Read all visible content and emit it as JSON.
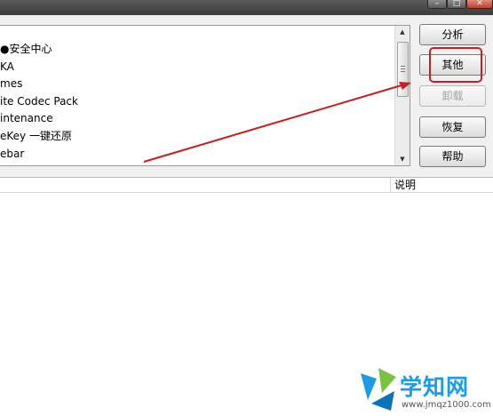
{
  "list": {
    "items": [
      "●安全中心",
      "KA",
      "mes",
      "ite Codec Pack",
      "intenance",
      "eKey 一键还原",
      "ebar"
    ]
  },
  "buttons": {
    "analyze": "分析",
    "other": "其他",
    "uninstall": "卸载",
    "restore": "恢复",
    "help": "帮助"
  },
  "detail": {
    "column_description": "说明"
  },
  "watermark": {
    "name": "学知网",
    "url": "www.jmqz1000.com"
  },
  "colors": {
    "annotation": "#c62020",
    "watermark": "#1e9be6"
  }
}
